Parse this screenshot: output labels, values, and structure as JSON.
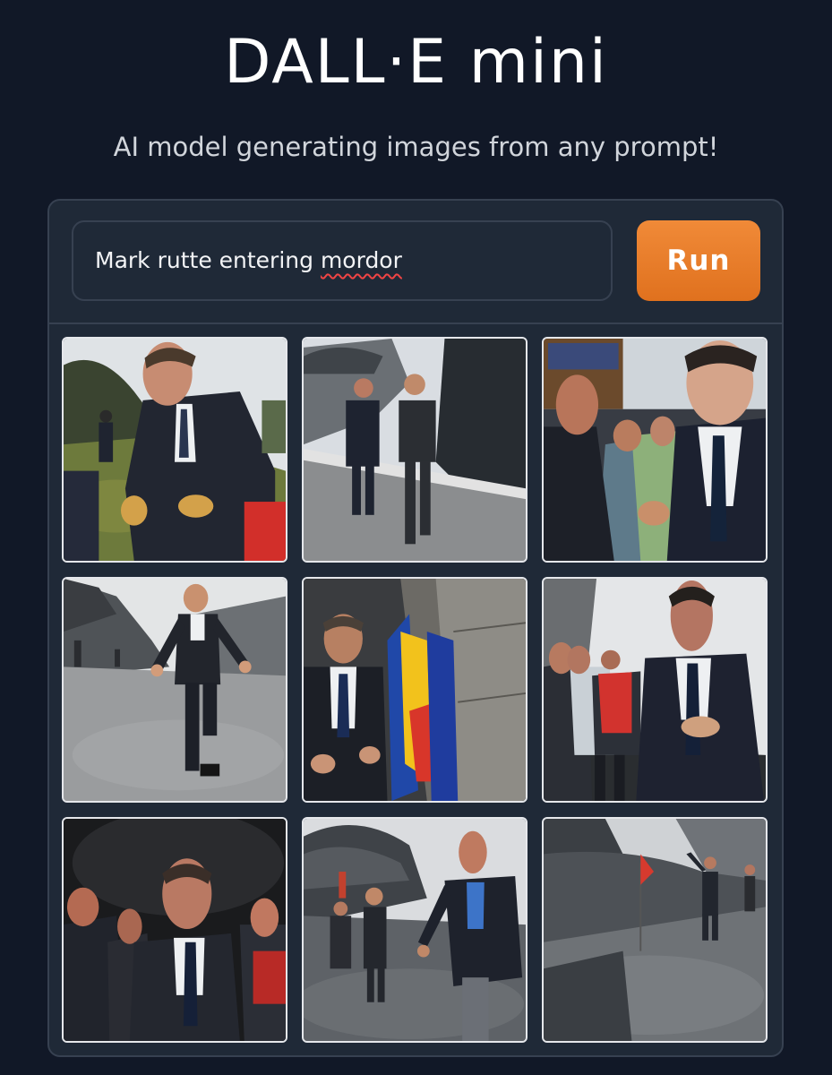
{
  "header": {
    "title": "DALL·E mini",
    "subtitle": "AI model generating images from any prompt!"
  },
  "prompt": {
    "value_before": "Mark rutte entering ",
    "value_misspelled": "mordor",
    "button_label": "Run"
  },
  "colors": {
    "background": "#111827",
    "panel": "#1f2937",
    "accent": "#e87a28",
    "spellcheck": "#ef4444"
  },
  "results": {
    "count": 9,
    "images": [
      {
        "id": 1,
        "icon": "generated-image"
      },
      {
        "id": 2,
        "icon": "generated-image"
      },
      {
        "id": 3,
        "icon": "generated-image"
      },
      {
        "id": 4,
        "icon": "generated-image"
      },
      {
        "id": 5,
        "icon": "generated-image"
      },
      {
        "id": 6,
        "icon": "generated-image"
      },
      {
        "id": 7,
        "icon": "generated-image"
      },
      {
        "id": 8,
        "icon": "generated-image"
      },
      {
        "id": 9,
        "icon": "generated-image"
      }
    ]
  }
}
